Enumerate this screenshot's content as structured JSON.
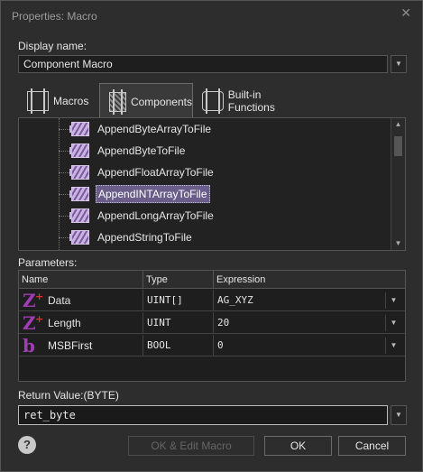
{
  "window": {
    "title": "Properties: Macro",
    "close_glyph": "✕"
  },
  "display_name": {
    "label": "Display name:",
    "value": "Component Macro"
  },
  "tabs": [
    {
      "label": "Macros",
      "icon": "macros-tab-icon",
      "active": false
    },
    {
      "label": "Components",
      "icon": "components-tab-icon",
      "active": true
    },
    {
      "label": "Built-in Functions",
      "icon": "builtin-functions-tab-icon",
      "active": false
    }
  ],
  "tree": {
    "items": [
      {
        "label": "AppendByteArrayToFile",
        "selected": false
      },
      {
        "label": "AppendByteToFile",
        "selected": false
      },
      {
        "label": "AppendFloatArrayToFile",
        "selected": false
      },
      {
        "label": "AppendINTArrayToFile",
        "selected": true
      },
      {
        "label": "AppendLongArrayToFile",
        "selected": false
      },
      {
        "label": "AppendStringToFile",
        "selected": false
      }
    ]
  },
  "parameters": {
    "label": "Parameters:",
    "columns": [
      "Name",
      "Type",
      "Expression"
    ],
    "rows": [
      {
        "icon": "Z",
        "icon_plus": "+",
        "name": "Data",
        "type": "UINT[]",
        "expression": "AG_XYZ"
      },
      {
        "icon": "Z",
        "icon_plus": "+",
        "name": "Length",
        "type": "UINT",
        "expression": "20"
      },
      {
        "icon": "b",
        "icon_plus": "",
        "name": "MSBFirst",
        "type": "BOOL",
        "expression": "0"
      }
    ]
  },
  "return_value": {
    "label": "Return Value:(BYTE)",
    "value": "ret_byte"
  },
  "buttons": {
    "help": "?",
    "ok_edit": "OK & Edit Macro",
    "ok": "OK",
    "cancel": "Cancel"
  },
  "glyphs": {
    "dropdown": "▼",
    "scroll_up": "▲",
    "scroll_down": "▼"
  },
  "colors": {
    "background": "#2d2d2d",
    "selection": "#6a5d8a",
    "variable_icon": "#a23cb6"
  }
}
